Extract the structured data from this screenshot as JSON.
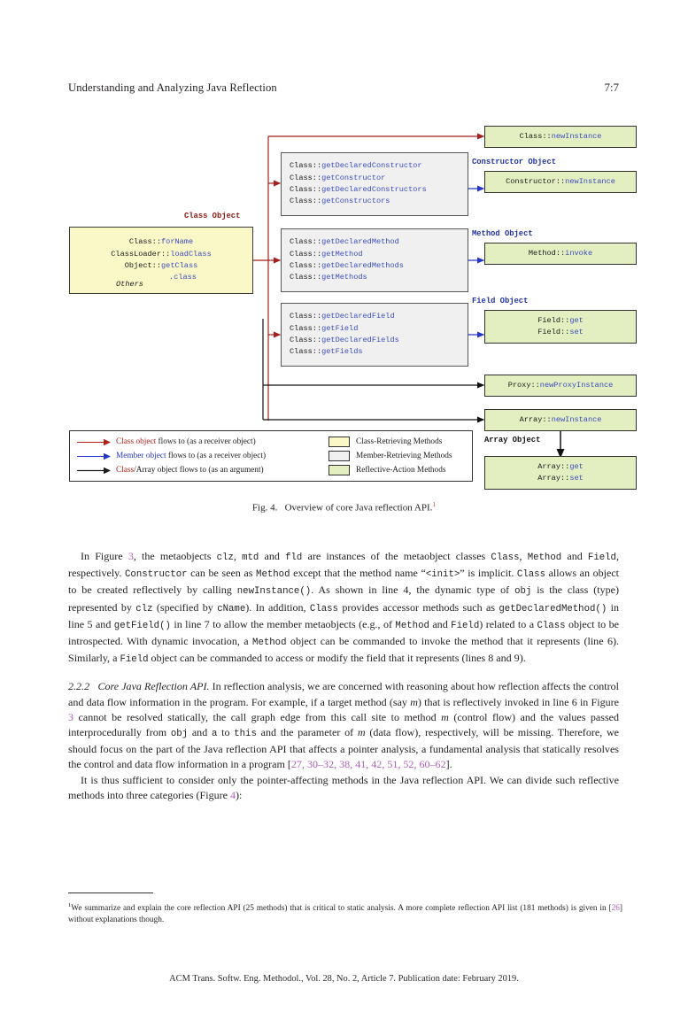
{
  "runhead": {
    "title": "Understanding and Analyzing Java Reflection",
    "page": "7:7"
  },
  "figure": {
    "class_object_label": "Class Object",
    "class_object_box": {
      "l1_cls": "Class::",
      "l1_mth": "forName",
      "l2_cls": "ClassLoader::",
      "l2_mth": "loadClass",
      "l3_cls": "Object::",
      "l3_mth": "getClass",
      "l4_mth": ".class",
      "l5_others": "Others"
    },
    "constructor_group": {
      "label": "Constructor Object",
      "methods": [
        {
          "cls": "Class::",
          "mth": "getDeclaredConstructor"
        },
        {
          "cls": "Class::",
          "mth": "getConstructor"
        },
        {
          "cls": "Class::",
          "mth": "getDeclaredConstructors"
        },
        {
          "cls": "Class::",
          "mth": "getConstructors"
        }
      ],
      "action": {
        "cls": "Constructor::",
        "mth": "newInstance"
      }
    },
    "method_group": {
      "label": "Method Object",
      "methods": [
        {
          "cls": "Class::",
          "mth": "getDeclaredMethod"
        },
        {
          "cls": "Class::",
          "mth": "getMethod"
        },
        {
          "cls": "Class::",
          "mth": "getDeclaredMethods"
        },
        {
          "cls": "Class::",
          "mth": "getMethods"
        }
      ],
      "action": {
        "cls": "Method::",
        "mth": "invoke"
      }
    },
    "field_group": {
      "label": "Field Object",
      "methods": [
        {
          "cls": "Class::",
          "mth": "getDeclaredField"
        },
        {
          "cls": "Class::",
          "mth": "getField"
        },
        {
          "cls": "Class::",
          "mth": "getDeclaredFields"
        },
        {
          "cls": "Class::",
          "mth": "getFields"
        }
      ],
      "action_get": {
        "cls": "Field::",
        "mth": "get"
      },
      "action_set": {
        "cls": "Field::",
        "mth": "set"
      }
    },
    "class_new_instance": {
      "cls": "Class::",
      "mth": "newInstance"
    },
    "proxy_new_proxy_instance": {
      "cls": "Proxy::",
      "mth": "newProxyInstance"
    },
    "array_new_instance": {
      "cls": "Array::",
      "mth": "newInstance"
    },
    "array_object_label": "Array Object",
    "array_get": {
      "cls": "Array::",
      "mth": "get"
    },
    "array_set": {
      "cls": "Array::",
      "mth": "set"
    },
    "legend": {
      "rows": [
        {
          "color_name": "Class object",
          "rest": " flows to (as a receiver object)",
          "arrow_color": "#b32017",
          "name_color": "#b32017"
        },
        {
          "color_name": "Member object",
          "rest": " flows to (as a receiver object)",
          "arrow_color": "#2536c8",
          "name_color": "#2536c8"
        },
        {
          "color_name": "Class",
          "rest": "/Array object flows to (as an argument)",
          "arrow_color": "#1b1b1b",
          "name_color": "#b32017"
        }
      ],
      "swatches": [
        {
          "label": "Class-Retrieving Methods",
          "color": "#fbf8c8"
        },
        {
          "label": "Member-Retrieving Methods",
          "color": "#f0f0f0"
        },
        {
          "label": "Reflective-Action Methods",
          "color": "#e3efc0"
        }
      ]
    },
    "caption_prefix": "Fig. 4.",
    "caption_text": "Overview of core Java reflection API.",
    "caption_footnote_marker": "1"
  },
  "body": {
    "para1": {
      "s1": "In Figure ",
      "r1": "3",
      "s2": ", the metaobjects ",
      "c1": "clz",
      "s3": ", ",
      "c2": "mtd",
      "s4": " and ",
      "c3": "fld",
      "s5": " are instances of the metaobject classes ",
      "c4": "Class",
      "s6": ", ",
      "c5": "Method",
      "s7": " and ",
      "c6": "Field",
      "s8": ", respectively. ",
      "c7": "Constructor",
      "s9": " can be seen as ",
      "c8": "Method",
      "s10": " except that the method name “",
      "c9": "<init>",
      "s11": "” is implicit. ",
      "c10": "Class",
      "s12": " allows an object to be created reflectively by calling ",
      "c11": "newInstance()",
      "s13": ". As shown in line 4, the dynamic type of ",
      "c12": "obj",
      "s14": " is the class (type) represented by ",
      "c13": "clz",
      "s15": " (specified by ",
      "c14": "cName",
      "s16": "). In addition, ",
      "c15": "Class",
      "s17": " provides accessor methods such as ",
      "c16": "getDeclaredMethod()",
      "s18": " in line 5 and ",
      "c17": "getField()",
      "s19": " in line 7 to allow the member metaobjects (e.g., of ",
      "c18": "Method",
      "s20": " and ",
      "c19": "Field",
      "s21": ") related to a ",
      "c20": "Class",
      "s22": " object to be introspected. With dynamic invocation, a ",
      "c21": "Method",
      "s23": " object can be commanded to invoke the method that it represents (line 6). Similarly, a ",
      "c22": "Field",
      "s24": " object can be commanded to access or modify the field that it represents (lines 8 and 9)."
    },
    "para2": {
      "num": "2.2.2",
      "heading": "Core Java Reflection API.",
      "s1": " In reflection analysis, we are concerned with reasoning about how reflection affects the control and data flow information in the program. For example, if a target method (say ",
      "m1": "m",
      "s2": ") that is reflectively invoked in line 6 in Figure ",
      "r1": "3",
      "s3": " cannot be resolved statically, the call graph edge from this call site to method ",
      "m2": "m",
      "s4": " (control flow) and the values passed interprocedurally from ",
      "c1": "obj",
      "s5": " and ",
      "c2": "a",
      "s6": " to ",
      "c3": "this",
      "s7": " and the parameter of ",
      "m3": "m",
      "s8": " (data flow), respectively, will be missing. Therefore, we should focus on the part of the Java reflection API that affects a pointer analysis, a fundamental analysis that statically resolves the control and data flow information in a program [",
      "refs": "27, 30–32, 38, 41, 42, 51, 52, 60–62",
      "s9": "]."
    },
    "para3": {
      "s1": "It is thus sufficient to consider only the pointer-affecting methods in the Java reflection API. We can divide such reflective methods into three categories (Figure ",
      "r1": "4",
      "s2": "):"
    }
  },
  "footnote": {
    "marker": "1",
    "s1": "We summarize and explain the core reflection API (25 methods) that is critical to static analysis. A more complete reflection API list (181 methods) is given in [",
    "ref": "26",
    "s2": "] without explanations though."
  },
  "footer": {
    "text": "ACM Trans. Softw. Eng. Methodol., Vol. 28, No. 2, Article 7. Publication date: February 2019."
  }
}
